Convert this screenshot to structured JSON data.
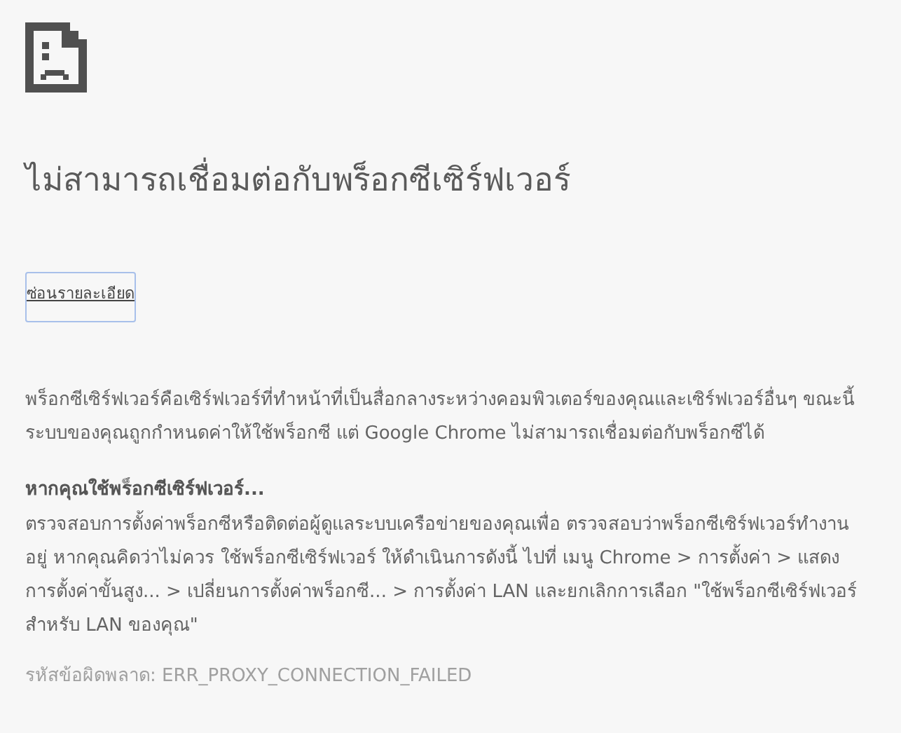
{
  "title": "ไม่สามารถเชื่อมต่อกับพร็อกซีเซิร์ฟเวอร์",
  "details_button": {
    "label": "ซ่อนรายละเอียด"
  },
  "description": "พร็อกซีเซิร์ฟเวอร์คือเซิร์ฟเวอร์ที่ทำหน้าที่เป็นสื่อกลางระหว่างคอมพิวเตอร์ของคุณและเซิร์ฟเวอร์อื่นๆ ขณะนี้ระบบของคุณถูกกำหนดค่าให้ใช้พร็อกซี แต่ Google Chrome ไม่สามารถเชื่อมต่อกับพร็อกซีได้",
  "suggestion_heading": "หากคุณใช้พร็อกซีเซิร์ฟเวอร์...",
  "suggestion_body": "ตรวจสอบการตั้งค่าพร็อกซีหรือติดต่อผู้ดูแลระบบเครือข่ายของคุณเพื่อ ตรวจสอบว่าพร็อกซีเซิร์ฟเวอร์ทำงานอยู่ หากคุณคิดว่าไม่ควร ใช้พร็อกซีเซิร์ฟเวอร์ ให้ดำเนินการดังนี้ ไปที่ เมนู Chrome > การตั้งค่า > แสดงการตั้งค่าขั้นสูง... > เปลี่ยนการตั้งค่าพร็อกซี... > การตั้งค่า LAN และยกเลิกการเลือก \"ใช้พร็อกซีเซิร์ฟเวอร์สำหรับ LAN ของคุณ\"",
  "error_code": "รหัสข้อผิดพลาด: ERR_PROXY_CONNECTION_FAILED"
}
